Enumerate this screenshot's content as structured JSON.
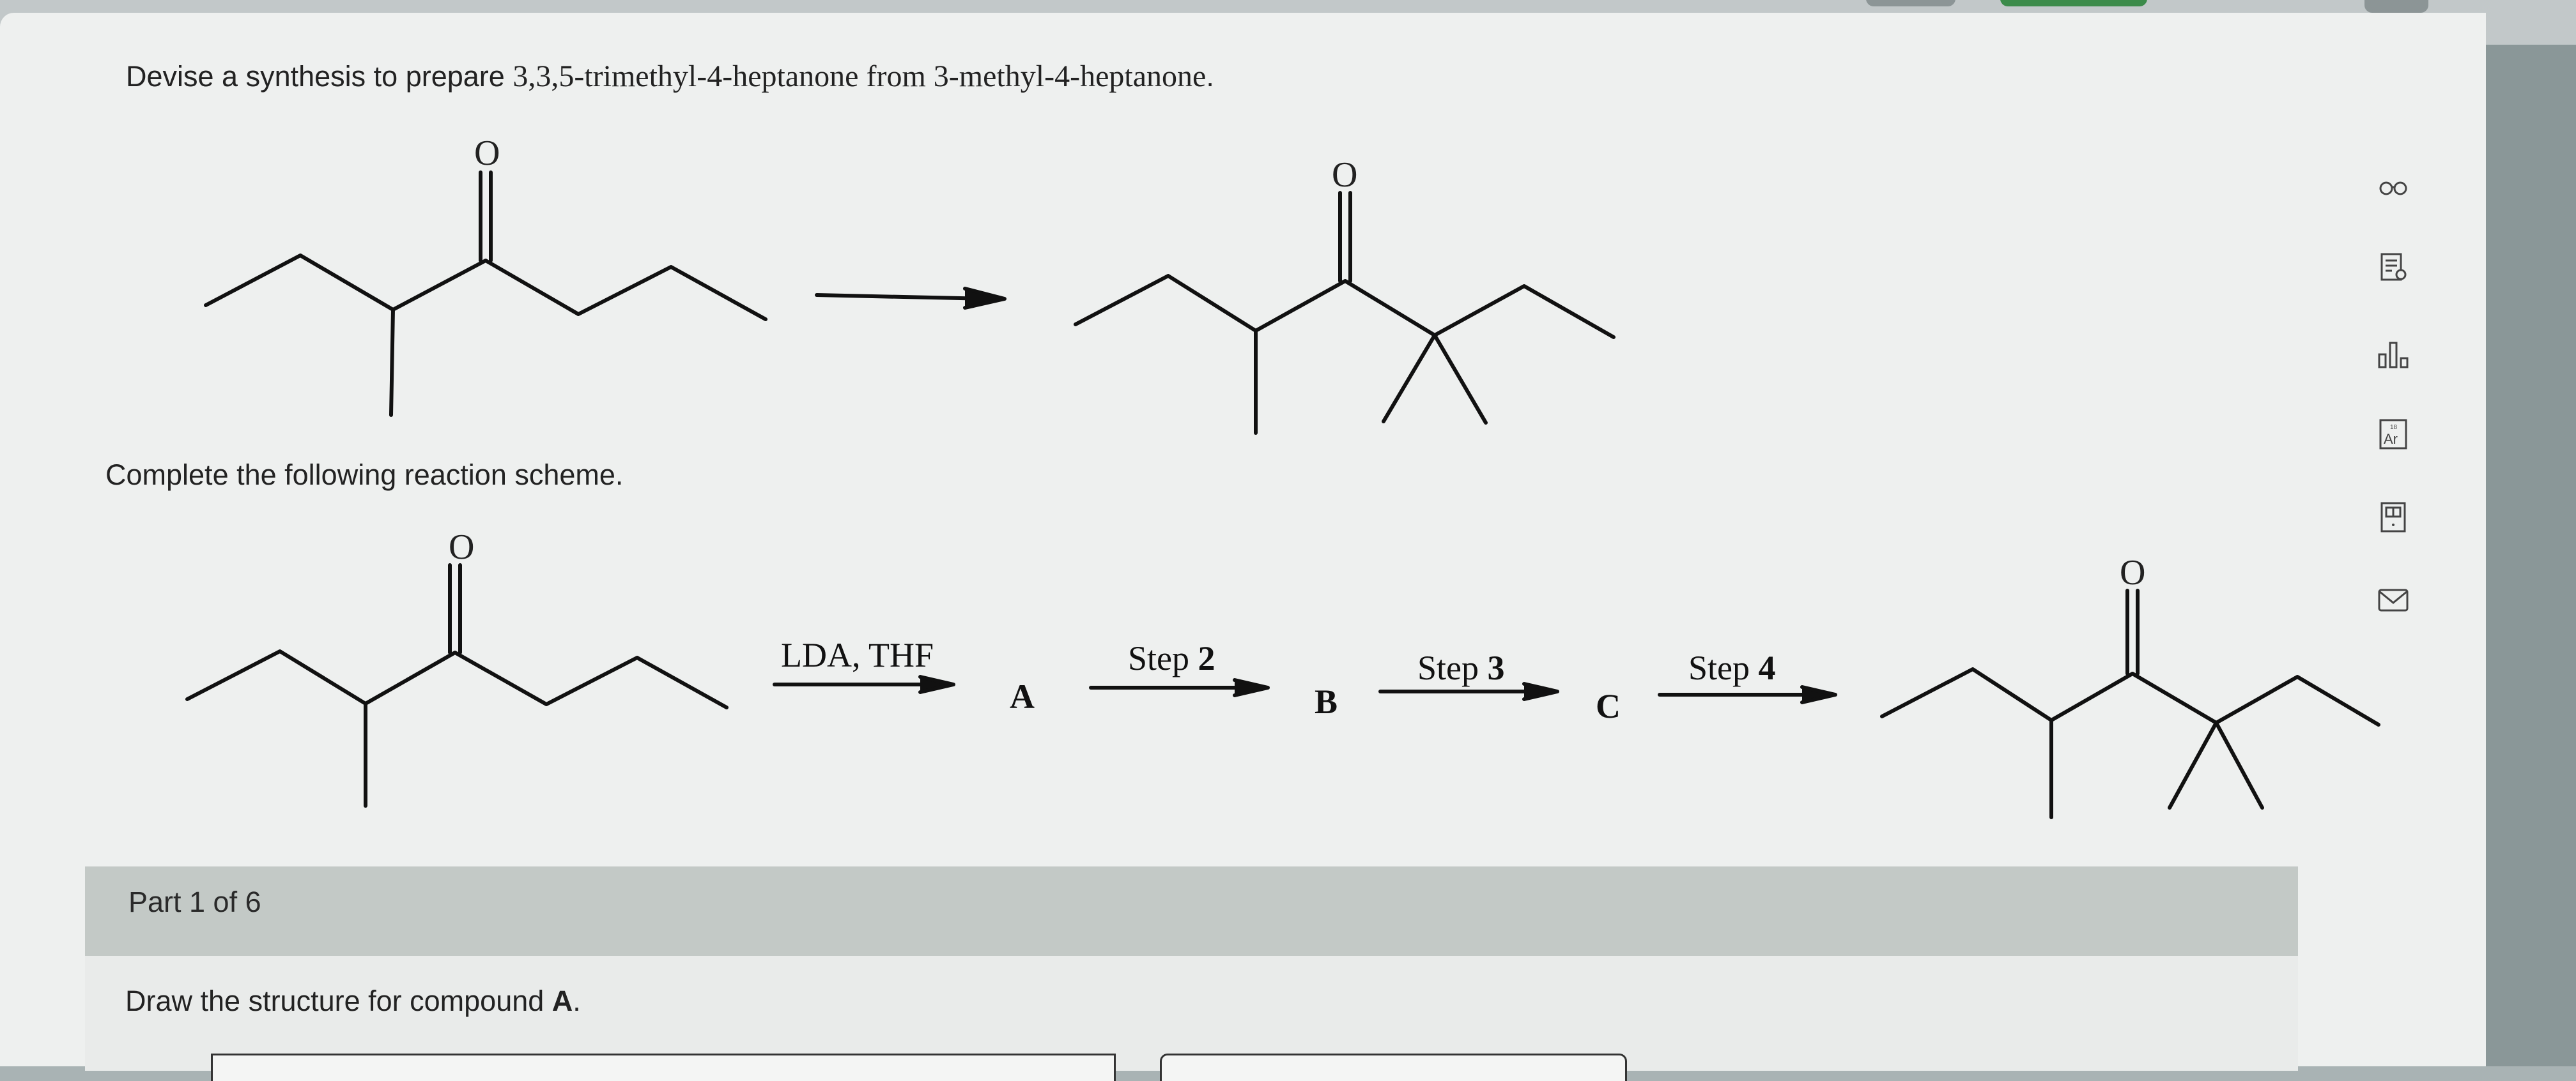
{
  "question": {
    "prefix": "Devise a synthesis to prepare ",
    "target": "3,3,5-trimethyl-4-heptanone",
    "mid": " from ",
    "start": "3-methyl-4-heptanone",
    "suffix": "."
  },
  "atom_label": "O",
  "instruction": "Complete the following reaction scheme.",
  "scheme": {
    "step1_reagent": "LDA, THF",
    "step2_word": "Step",
    "step2_num": "2",
    "step3_word": "Step",
    "step3_num": "3",
    "step4_word": "Step",
    "step4_num": "4",
    "compound_a": "A",
    "compound_b": "B",
    "compound_c": "C"
  },
  "toolbar": {
    "icons": [
      "glasses-icon",
      "document-search-icon",
      "bar-chart-icon",
      "periodic-table-icon",
      "calculator-icon",
      "mail-icon"
    ],
    "periodic_label": "Ar",
    "periodic_number": "18"
  },
  "part": {
    "label": "Part 1 of 6",
    "prompt_prefix": "Draw the structure for compound ",
    "prompt_bold": "A",
    "prompt_suffix": "."
  }
}
